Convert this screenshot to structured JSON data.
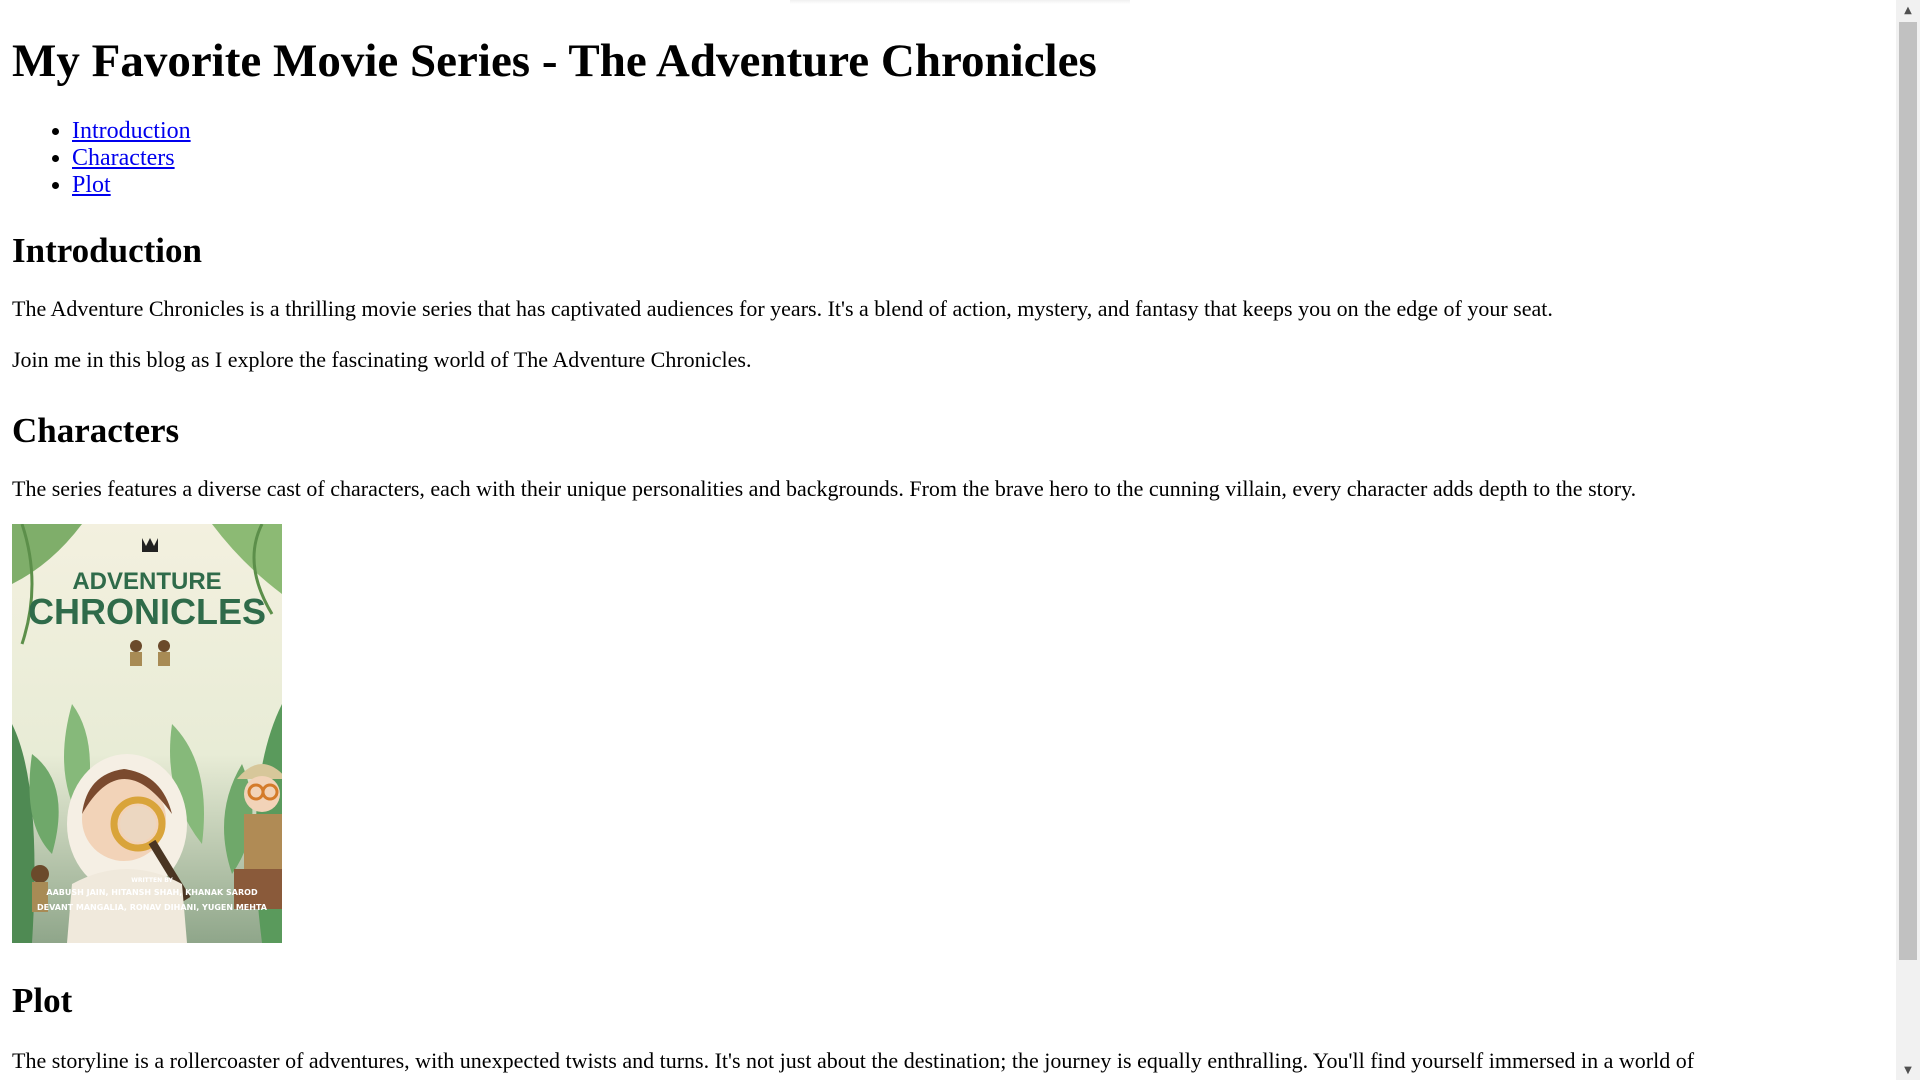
{
  "page": {
    "title": "My Favorite Movie Series - The Adventure Chronicles",
    "toc": [
      {
        "label": "Introduction"
      },
      {
        "label": "Characters"
      },
      {
        "label": "Plot"
      }
    ],
    "introduction": {
      "heading": "Introduction",
      "p1": "The Adventure Chronicles is a thrilling movie series that has captivated audiences for years. It's a blend of action, mystery, and fantasy that keeps you on the edge of your seat.",
      "p2": "Join me in this blog as I explore the fascinating world of The Adventure Chronicles."
    },
    "characters": {
      "heading": "Characters",
      "p1": "The series features a diverse cast of characters, each with their unique personalities and backgrounds. From the brave hero to the cunning villain, every character adds depth to the story."
    },
    "cover": {
      "title_top": "ADVENTURE",
      "title_bottom": "CHRONICLES",
      "written_by": "WRITTEN BY",
      "authors_line1": "AABUSH JAIN, HITANSH SHAH, KHANAK SAROD",
      "authors_line2": "DEVANT MANGALIA, RONAV DIHANI, YUGEN MEHTA"
    },
    "plot": {
      "heading": "Plot",
      "p1": "The storyline is a rollercoaster of adventures, with unexpected twists and turns. It's not just about the destination; the journey is equally enthralling. You'll find yourself immersed in a world of"
    }
  },
  "colors": {
    "link": "#0000ee",
    "scrollbar_track": "#f1f1f1",
    "scrollbar_thumb": "#c1c1c1"
  },
  "icons": {
    "scroll_up": "triangle-up-icon",
    "scroll_down": "triangle-down-icon"
  }
}
